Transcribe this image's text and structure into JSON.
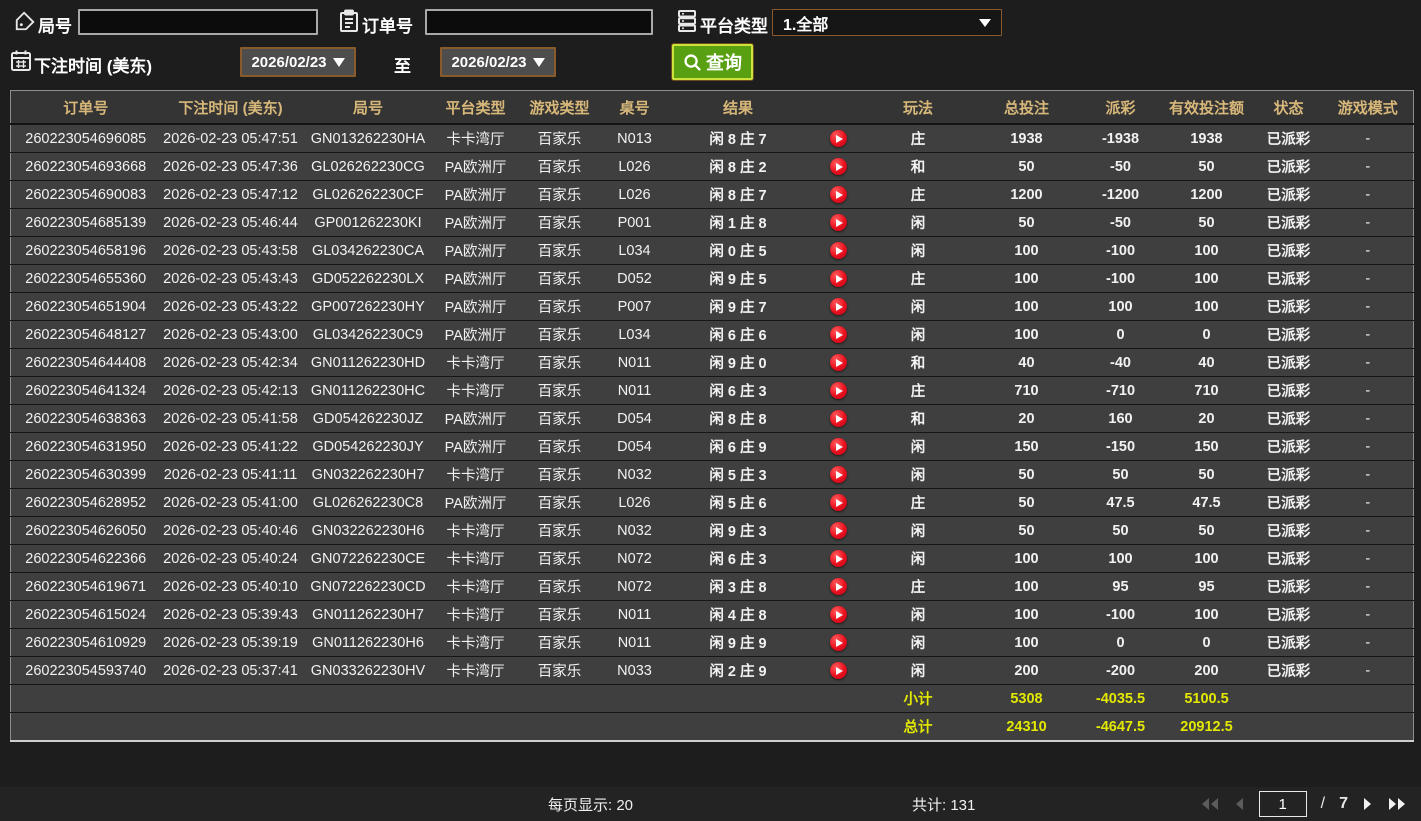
{
  "filters": {
    "round_label": "局号",
    "order_label": "订单号",
    "platform_label": "平台类型",
    "platform_value": "1.全部",
    "bet_time_label": "下注时间 (美东)",
    "date_from": "2026/02/23",
    "date_to": "2026/02/23",
    "to_label": "至",
    "search_label": "查询"
  },
  "table": {
    "headers": {
      "order_id": "订单号",
      "bet_time": "下注时间 (美东)",
      "round_id": "局号",
      "platform": "平台类型",
      "game_type": "游戏类型",
      "table_no": "桌号",
      "result": "结果",
      "play": "玩法",
      "total_bet": "总投注",
      "payout": "派彩",
      "valid_bet": "有效投注额",
      "status": "状态",
      "game_mode": "游戏模式"
    },
    "rows": [
      {
        "order_id": "260223054696085",
        "bet_time": "2026-02-23 05:47:51",
        "round_id": "GN013262230HA",
        "platform": "卡卡湾厅",
        "game_type": "百家乐",
        "table_no": "N013",
        "result": "闲 8 庄 7",
        "play": "庄",
        "total_bet": "1938",
        "payout": "-1938",
        "valid_bet": "1938",
        "status": "已派彩",
        "game_mode": "-"
      },
      {
        "order_id": "260223054693668",
        "bet_time": "2026-02-23 05:47:36",
        "round_id": "GL026262230CG",
        "platform": "PA欧洲厅",
        "game_type": "百家乐",
        "table_no": "L026",
        "result": "闲 8 庄 2",
        "play": "和",
        "total_bet": "50",
        "payout": "-50",
        "valid_bet": "50",
        "status": "已派彩",
        "game_mode": "-"
      },
      {
        "order_id": "260223054690083",
        "bet_time": "2026-02-23 05:47:12",
        "round_id": "GL026262230CF",
        "platform": "PA欧洲厅",
        "game_type": "百家乐",
        "table_no": "L026",
        "result": "闲 8 庄 7",
        "play": "庄",
        "total_bet": "1200",
        "payout": "-1200",
        "valid_bet": "1200",
        "status": "已派彩",
        "game_mode": "-"
      },
      {
        "order_id": "260223054685139",
        "bet_time": "2026-02-23 05:46:44",
        "round_id": "GP001262230KI",
        "platform": "PA欧洲厅",
        "game_type": "百家乐",
        "table_no": "P001",
        "result": "闲 1 庄 8",
        "play": "闲",
        "total_bet": "50",
        "payout": "-50",
        "valid_bet": "50",
        "status": "已派彩",
        "game_mode": "-"
      },
      {
        "order_id": "260223054658196",
        "bet_time": "2026-02-23 05:43:58",
        "round_id": "GL034262230CA",
        "platform": "PA欧洲厅",
        "game_type": "百家乐",
        "table_no": "L034",
        "result": "闲 0 庄 5",
        "play": "闲",
        "total_bet": "100",
        "payout": "-100",
        "valid_bet": "100",
        "status": "已派彩",
        "game_mode": "-"
      },
      {
        "order_id": "260223054655360",
        "bet_time": "2026-02-23 05:43:43",
        "round_id": "GD052262230LX",
        "platform": "PA欧洲厅",
        "game_type": "百家乐",
        "table_no": "D052",
        "result": "闲 9 庄 5",
        "play": "庄",
        "total_bet": "100",
        "payout": "-100",
        "valid_bet": "100",
        "status": "已派彩",
        "game_mode": "-"
      },
      {
        "order_id": "260223054651904",
        "bet_time": "2026-02-23 05:43:22",
        "round_id": "GP007262230HY",
        "platform": "PA欧洲厅",
        "game_type": "百家乐",
        "table_no": "P007",
        "result": "闲 9 庄 7",
        "play": "闲",
        "total_bet": "100",
        "payout": "100",
        "valid_bet": "100",
        "status": "已派彩",
        "game_mode": "-"
      },
      {
        "order_id": "260223054648127",
        "bet_time": "2026-02-23 05:43:00",
        "round_id": "GL034262230C9",
        "platform": "PA欧洲厅",
        "game_type": "百家乐",
        "table_no": "L034",
        "result": "闲 6 庄 6",
        "play": "闲",
        "total_bet": "100",
        "payout": "0",
        "valid_bet": "0",
        "status": "已派彩",
        "game_mode": "-"
      },
      {
        "order_id": "260223054644408",
        "bet_time": "2026-02-23 05:42:34",
        "round_id": "GN011262230HD",
        "platform": "卡卡湾厅",
        "game_type": "百家乐",
        "table_no": "N011",
        "result": "闲 9 庄 0",
        "play": "和",
        "total_bet": "40",
        "payout": "-40",
        "valid_bet": "40",
        "status": "已派彩",
        "game_mode": "-"
      },
      {
        "order_id": "260223054641324",
        "bet_time": "2026-02-23 05:42:13",
        "round_id": "GN011262230HC",
        "platform": "卡卡湾厅",
        "game_type": "百家乐",
        "table_no": "N011",
        "result": "闲 6 庄 3",
        "play": "庄",
        "total_bet": "710",
        "payout": "-710",
        "valid_bet": "710",
        "status": "已派彩",
        "game_mode": "-"
      },
      {
        "order_id": "260223054638363",
        "bet_time": "2026-02-23 05:41:58",
        "round_id": "GD054262230JZ",
        "platform": "PA欧洲厅",
        "game_type": "百家乐",
        "table_no": "D054",
        "result": "闲 8 庄 8",
        "play": "和",
        "total_bet": "20",
        "payout": "160",
        "valid_bet": "20",
        "status": "已派彩",
        "game_mode": "-"
      },
      {
        "order_id": "260223054631950",
        "bet_time": "2026-02-23 05:41:22",
        "round_id": "GD054262230JY",
        "platform": "PA欧洲厅",
        "game_type": "百家乐",
        "table_no": "D054",
        "result": "闲 6 庄 9",
        "play": "闲",
        "total_bet": "150",
        "payout": "-150",
        "valid_bet": "150",
        "status": "已派彩",
        "game_mode": "-"
      },
      {
        "order_id": "260223054630399",
        "bet_time": "2026-02-23 05:41:11",
        "round_id": "GN032262230H7",
        "platform": "卡卡湾厅",
        "game_type": "百家乐",
        "table_no": "N032",
        "result": "闲 5 庄 3",
        "play": "闲",
        "total_bet": "50",
        "payout": "50",
        "valid_bet": "50",
        "status": "已派彩",
        "game_mode": "-"
      },
      {
        "order_id": "260223054628952",
        "bet_time": "2026-02-23 05:41:00",
        "round_id": "GL026262230C8",
        "platform": "PA欧洲厅",
        "game_type": "百家乐",
        "table_no": "L026",
        "result": "闲 5 庄 6",
        "play": "庄",
        "total_bet": "50",
        "payout": "47.5",
        "valid_bet": "47.5",
        "status": "已派彩",
        "game_mode": "-"
      },
      {
        "order_id": "260223054626050",
        "bet_time": "2026-02-23 05:40:46",
        "round_id": "GN032262230H6",
        "platform": "卡卡湾厅",
        "game_type": "百家乐",
        "table_no": "N032",
        "result": "闲 9 庄 3",
        "play": "闲",
        "total_bet": "50",
        "payout": "50",
        "valid_bet": "50",
        "status": "已派彩",
        "game_mode": "-"
      },
      {
        "order_id": "260223054622366",
        "bet_time": "2026-02-23 05:40:24",
        "round_id": "GN072262230CE",
        "platform": "卡卡湾厅",
        "game_type": "百家乐",
        "table_no": "N072",
        "result": "闲 6 庄 3",
        "play": "闲",
        "total_bet": "100",
        "payout": "100",
        "valid_bet": "100",
        "status": "已派彩",
        "game_mode": "-"
      },
      {
        "order_id": "260223054619671",
        "bet_time": "2026-02-23 05:40:10",
        "round_id": "GN072262230CD",
        "platform": "卡卡湾厅",
        "game_type": "百家乐",
        "table_no": "N072",
        "result": "闲 3 庄 8",
        "play": "庄",
        "total_bet": "100",
        "payout": "95",
        "valid_bet": "95",
        "status": "已派彩",
        "game_mode": "-"
      },
      {
        "order_id": "260223054615024",
        "bet_time": "2026-02-23 05:39:43",
        "round_id": "GN011262230H7",
        "platform": "卡卡湾厅",
        "game_type": "百家乐",
        "table_no": "N011",
        "result": "闲 4 庄 8",
        "play": "闲",
        "total_bet": "100",
        "payout": "-100",
        "valid_bet": "100",
        "status": "已派彩",
        "game_mode": "-"
      },
      {
        "order_id": "260223054610929",
        "bet_time": "2026-02-23 05:39:19",
        "round_id": "GN011262230H6",
        "platform": "卡卡湾厅",
        "game_type": "百家乐",
        "table_no": "N011",
        "result": "闲 9 庄 9",
        "play": "闲",
        "total_bet": "100",
        "payout": "0",
        "valid_bet": "0",
        "status": "已派彩",
        "game_mode": "-"
      },
      {
        "order_id": "260223054593740",
        "bet_time": "2026-02-23 05:37:41",
        "round_id": "GN033262230HV",
        "platform": "卡卡湾厅",
        "game_type": "百家乐",
        "table_no": "N033",
        "result": "闲 2 庄 9",
        "play": "闲",
        "total_bet": "200",
        "payout": "-200",
        "valid_bet": "200",
        "status": "已派彩",
        "game_mode": "-"
      }
    ],
    "subtotal": {
      "label": "小计",
      "total_bet": "5308",
      "payout": "-4035.5",
      "valid_bet": "5100.5"
    },
    "total": {
      "label": "总计",
      "total_bet": "24310",
      "payout": "-4647.5",
      "valid_bet": "20912.5"
    }
  },
  "footer": {
    "page_size_text": "每页显示: 20",
    "total_count_text": "共计: 131",
    "current_page": "1",
    "page_separator": "/",
    "total_pages": "7"
  },
  "colors": {
    "header_text": "#d8b87a",
    "payout_negative": "#97d31f",
    "payout_positive": "#9c1126",
    "status_paid": "#1fd549",
    "summary_yellow": "#e3e800",
    "search_button": "#58a011",
    "date_border": "#8a5a2b"
  }
}
